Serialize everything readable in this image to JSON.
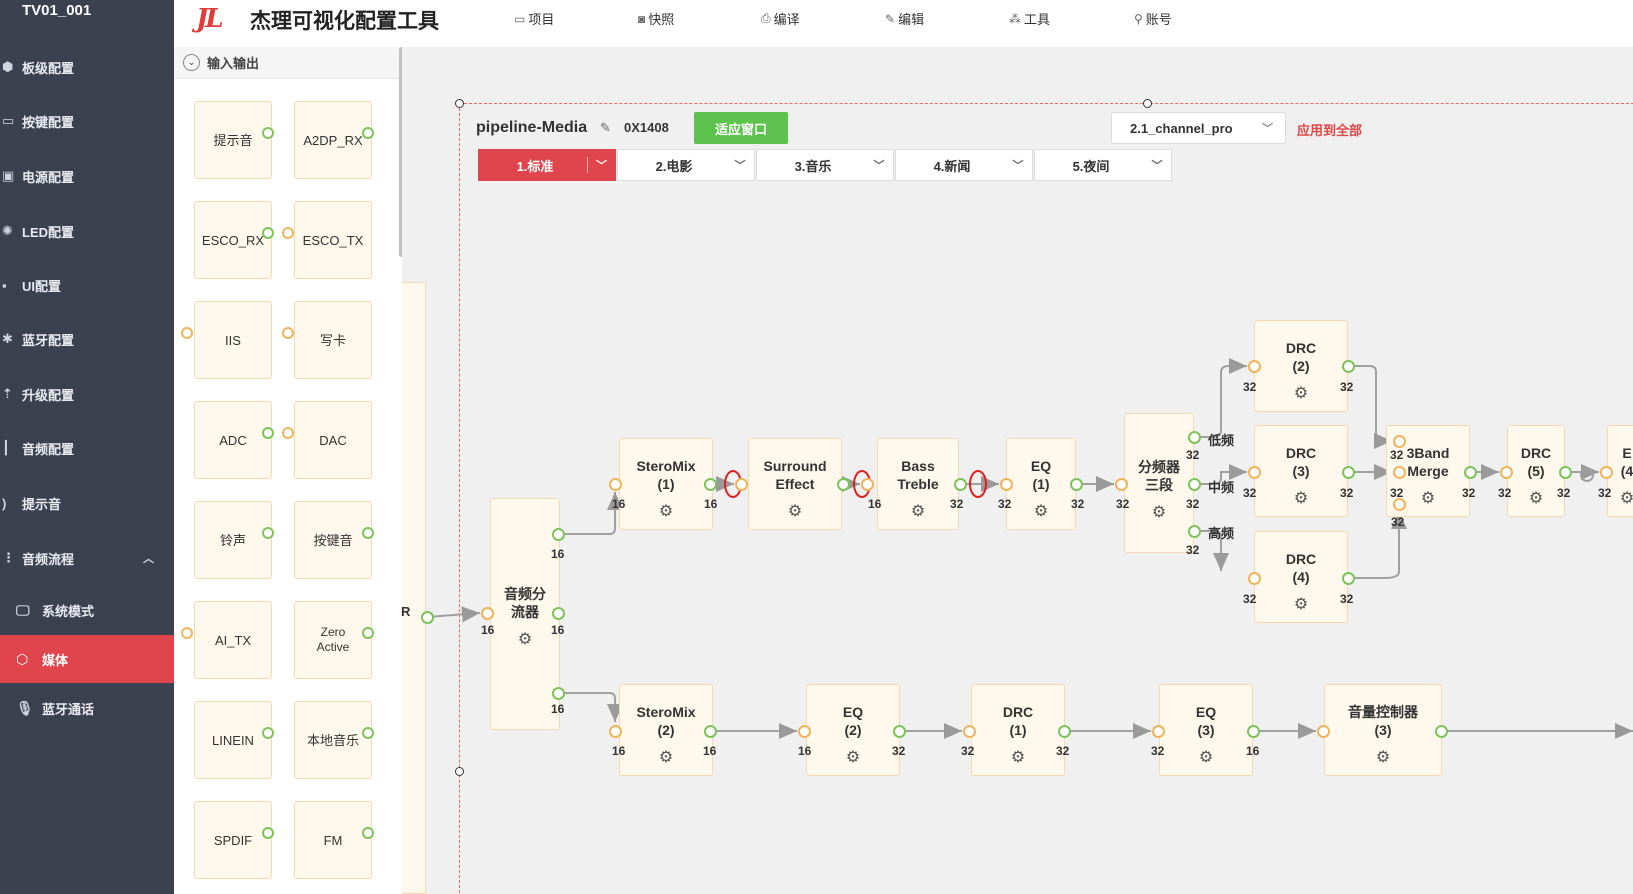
{
  "sidebar": {
    "title": "TV01_001",
    "items": [
      {
        "label": "板级配置",
        "icon": "board-icon"
      },
      {
        "label": "按键配置",
        "icon": "key-icon"
      },
      {
        "label": "电源配置",
        "icon": "power-icon"
      },
      {
        "label": "LED配置",
        "icon": "led-icon"
      },
      {
        "label": "UI配置",
        "icon": "ui-icon"
      },
      {
        "label": "蓝牙配置",
        "icon": "bluetooth-icon"
      },
      {
        "label": "升级配置",
        "icon": "upgrade-icon"
      },
      {
        "label": "音频配置",
        "icon": "audio-icon"
      },
      {
        "label": "提示音",
        "icon": "tone-icon"
      },
      {
        "label": "音频流程",
        "icon": "flow-icon"
      }
    ],
    "subitems": [
      {
        "label": "系统模式",
        "icon": "monitor-icon"
      },
      {
        "label": "媒体",
        "icon": "cube-icon"
      },
      {
        "label": "蓝牙通话",
        "icon": "mic-icon"
      }
    ]
  },
  "header": {
    "logo": "JL",
    "title": "杰理可视化配置工具",
    "menu": [
      {
        "label": "项目",
        "icon": "folder-icon"
      },
      {
        "label": "快照",
        "icon": "camera-icon"
      },
      {
        "label": "编译",
        "icon": "printer-icon"
      },
      {
        "label": "编辑",
        "icon": "pencil-icon"
      },
      {
        "label": "工具",
        "icon": "wand-icon"
      },
      {
        "label": "账号",
        "icon": "user-icon"
      }
    ]
  },
  "palette": {
    "section": "输入输出",
    "nodes": [
      "提示音",
      "A2DP_RX",
      "ESCO_RX",
      "ESCO_TX",
      "IIS",
      "写卡",
      "ADC",
      "DAC",
      "铃声",
      "按键音",
      "AI_TX",
      "Zero Active",
      "LINEIN",
      "本地音乐",
      "SPDIF",
      "FM"
    ]
  },
  "pipeline": {
    "name": "pipeline-Media",
    "address": "0X1408",
    "fit_button": "适应窗口",
    "preset": "2.1_channel_pro",
    "apply_all": "应用到全部",
    "tabs": [
      "1.标准",
      "2.电影",
      "3.音乐",
      "4.新闻",
      "5.夜间"
    ],
    "strip_label": "R",
    "nodes": [
      {
        "label": "音频分流器",
        "nums": [
          "16",
          "16",
          "16",
          "16"
        ]
      },
      {
        "label": "SteroMix (1)",
        "nums": [
          "16",
          "16"
        ]
      },
      {
        "label": "Surround Effect",
        "nums": []
      },
      {
        "label": "Bass Treble",
        "nums": [
          "16"
        ]
      },
      {
        "label": "EQ (1)",
        "nums": [
          "32",
          "32",
          "32"
        ]
      },
      {
        "label": "分频器三段",
        "nums": [
          "32",
          "32",
          "32",
          "32"
        ]
      },
      {
        "label": "DRC (2)",
        "nums": [
          "32",
          "32"
        ]
      },
      {
        "label": "DRC (3)",
        "nums": [
          "32",
          "32"
        ]
      },
      {
        "label": "DRC (4)",
        "nums": [
          "32",
          "32"
        ]
      },
      {
        "label": "3Band Merge",
        "nums": [
          "32",
          "32",
          "32",
          "32"
        ]
      },
      {
        "label": "DRC (5)",
        "nums": [
          "32",
          "32"
        ]
      },
      {
        "label": "E (4",
        "nums": [
          "32"
        ]
      },
      {
        "label": "SteroMix (2)",
        "nums": [
          "16",
          "16"
        ]
      },
      {
        "label": "EQ (2)",
        "nums": [
          "16",
          "32"
        ]
      },
      {
        "label": "DRC (1)",
        "nums": [
          "32",
          "32"
        ]
      },
      {
        "label": "EQ (3)",
        "nums": [
          "32",
          "16"
        ]
      },
      {
        "label": "音量控制器 (3)",
        "nums": []
      }
    ],
    "band_labels": [
      "低频",
      "中频",
      "高频"
    ]
  },
  "colors": {
    "sidebar_bg": "#3c4150",
    "accent_red": "#e0454d",
    "fit_green": "#5cc34c",
    "node_bg": "#fff8ec",
    "port_out": "#7ec35a",
    "port_in": "#f0b45a"
  }
}
